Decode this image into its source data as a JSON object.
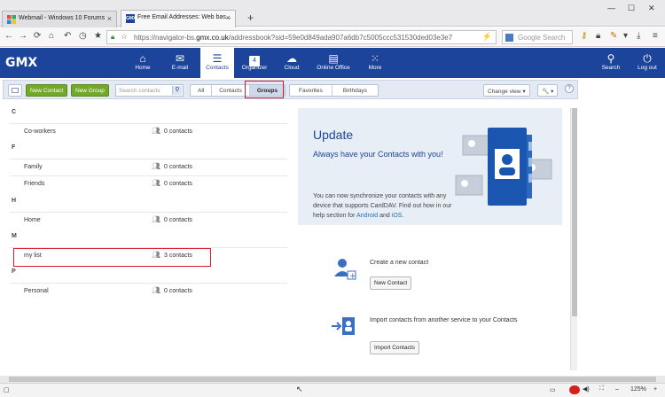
{
  "browser": {
    "tabs": [
      {
        "label": "Webmail - Windows 10 Forums"
      },
      {
        "label": "Free Email Addresses: Web bas..."
      }
    ],
    "url_prefix": "https://navigator-bs.",
    "url_domain": "gmx.co.uk",
    "url_suffix": "/addressbook?sid=59e0d849ada907a6db7c5005ccc531530ded03e3e7",
    "search_placeholder": "Google Search",
    "zoom": "125%"
  },
  "gmx": {
    "logo": "GMX",
    "nav": [
      {
        "label": "Home",
        "icon": "home-icon"
      },
      {
        "label": "E-mail",
        "icon": "mail-icon"
      },
      {
        "label": "Contacts",
        "icon": "contacts-icon"
      },
      {
        "label": "Organizer",
        "icon": "calendar-icon",
        "badge": "4"
      },
      {
        "label": "Cloud",
        "icon": "cloud-icon"
      },
      {
        "label": "Online Office",
        "icon": "office-icon"
      },
      {
        "label": "More",
        "icon": "grid-icon"
      }
    ],
    "right_nav": [
      {
        "label": "Search",
        "icon": "search-icon"
      },
      {
        "label": "Log out",
        "icon": "power-icon"
      }
    ]
  },
  "toolbar": {
    "new_contact": "New Contact",
    "new_group": "New Group",
    "search_placeholder": "Search contacts",
    "filters": [
      "All",
      "Contacts",
      "Groups"
    ],
    "filters2": [
      "Favorites",
      "Birthdays"
    ],
    "selected_filter": "Groups",
    "change_view": "Change view",
    "tools": "Tools",
    "help": "?"
  },
  "groups": [
    {
      "letter": "C",
      "items": [
        {
          "name": "Co-workers",
          "count": "0 contacts"
        }
      ]
    },
    {
      "letter": "F",
      "items": [
        {
          "name": "Family",
          "count": "0 contacts"
        },
        {
          "name": "Friends",
          "count": "0 contacts"
        }
      ]
    },
    {
      "letter": "H",
      "items": [
        {
          "name": "Home",
          "count": "0 contacts"
        }
      ]
    },
    {
      "letter": "M",
      "items": [
        {
          "name": "my list",
          "count": "3 contacts"
        }
      ]
    },
    {
      "letter": "P",
      "items": [
        {
          "name": "Personal",
          "count": "0 contacts"
        }
      ]
    }
  ],
  "banner": {
    "title": "Update",
    "subtitle": "Always have your Contacts with you!",
    "text": "You can now synchronize your contacts with any device that supports CardDAV. Find out how in our help section for",
    "link1": "Android",
    "and": "and",
    "link2": "iOS",
    "period": "."
  },
  "actions": {
    "create_label": "Create a new contact",
    "create_button": "New Contact",
    "import_label": "Import contacts from another service to your Contacts",
    "import_button": "Import Contacts"
  }
}
